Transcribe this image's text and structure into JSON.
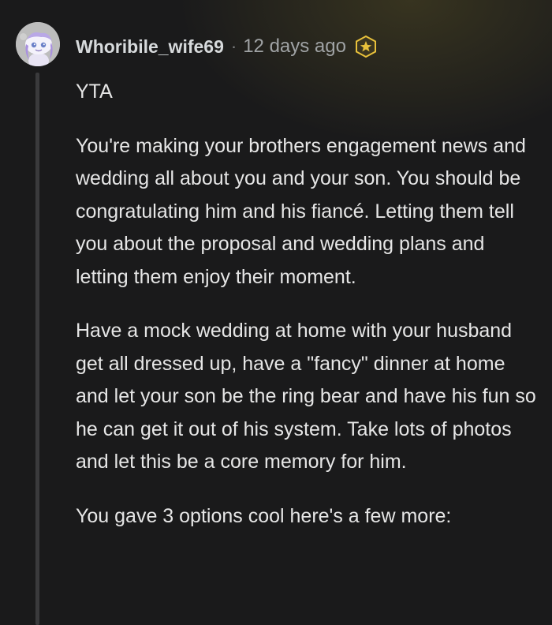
{
  "comment": {
    "username": "Whoribile_wife69",
    "separator": "·",
    "timestamp": "12 days ago",
    "award_icon": "award-badge-icon",
    "avatar_icon": "snoo-avatar-icon",
    "paragraphs": [
      "YTA",
      "You're making your brothers engagement news and wedding all about you and your son. You should be congratulating him and his fiancé. Letting them tell you about the proposal and wedding plans and letting them enjoy their moment.",
      "Have a mock wedding at home with your husband get all dressed up, have a \"fancy\" dinner at home and let your son be the ring bear and have his fun so he can get it out of his system. Take lots of photos and let this be a core memory for him.",
      "You gave 3 options cool here's a few more:"
    ]
  },
  "colors": {
    "background": "#1a1a1b",
    "text": "#e6e6e6",
    "muted": "#a0a3a5",
    "thread_line": "#3a3a3c",
    "award": "#e8c13b"
  }
}
